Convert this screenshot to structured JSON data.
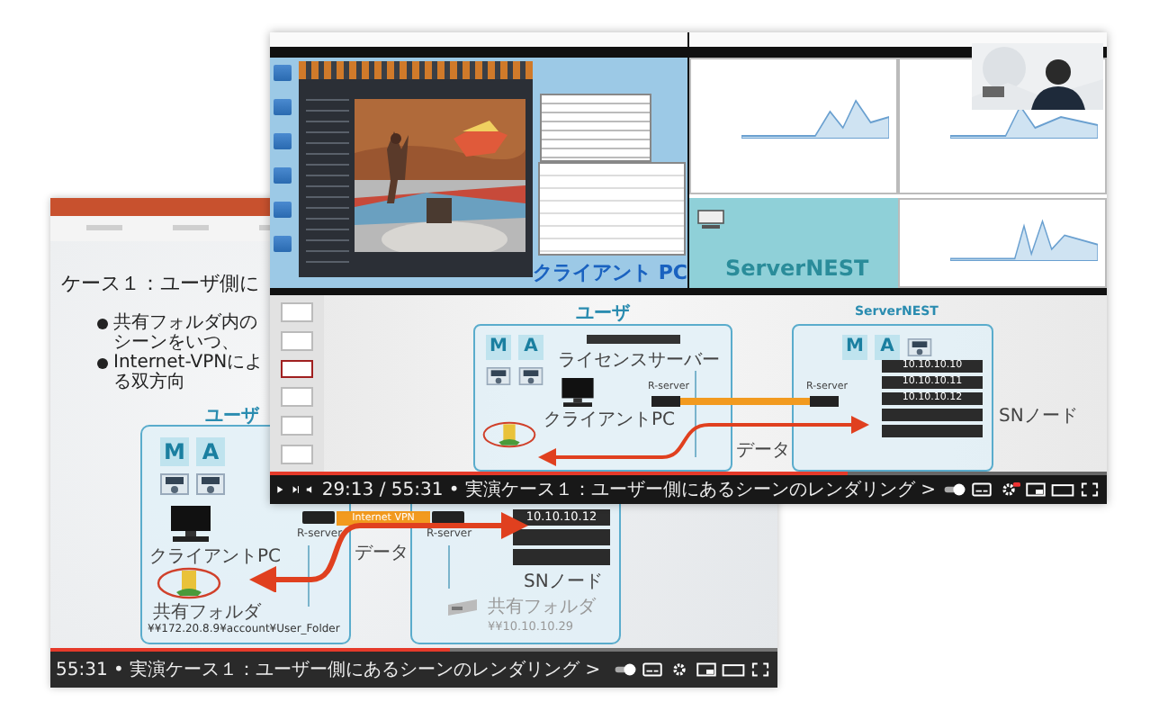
{
  "presentation_window": {
    "slide": {
      "heading": "ケース１：ユーザ側に",
      "bullets": [
        "共有フォルダ内のシーンをいつ、",
        "Internet-VPNによる双方向"
      ],
      "user_group": {
        "label": "ユーザ",
        "apps": [
          "M",
          "A"
        ],
        "client": "クライアントPC",
        "share_name": "共有フォルダ",
        "share_path": "¥¥172.20.8.9¥account¥User_Folder"
      },
      "network": {
        "r_servers": [
          "R-server",
          "R-server"
        ],
        "vpn": "Internet VPN",
        "data": "データ"
      },
      "server_group": {
        "nodes": [
          "10.10.10.12"
        ],
        "node_label": "SNノード",
        "share_name": "共有フォルダ",
        "share_path": "¥¥10.10.10.29"
      }
    },
    "player": {
      "level": 0.55,
      "caption": "55:31 • 実演ケース１：ユーザー側にあるシーンのレンダリング >"
    }
  },
  "demo_window": {
    "remote_desktops": [
      {
        "label": "クライアント PC"
      },
      {
        "label": "ServerNEST"
      }
    ],
    "slide": {
      "thumbnails": [
        {
          "selected": false
        },
        {
          "selected": false
        },
        {
          "selected": true
        },
        {
          "selected": false
        },
        {
          "selected": false
        },
        {
          "selected": false
        }
      ],
      "user_group": {
        "label": "ユーザ",
        "apps": [
          "M",
          "A"
        ],
        "license_server": "ライセンスサーバー",
        "client": "クライアントPC"
      },
      "network": {
        "r_servers": [
          "R-server",
          "R-server"
        ],
        "data": "データ"
      },
      "server_group": {
        "label": "ServerNEST",
        "apps": [
          "M",
          "A"
        ],
        "nodes": [
          "10.10.10.10",
          "10.10.10.11",
          "10.10.10.12"
        ],
        "node_label": "SNノード"
      }
    },
    "player": {
      "level": 0.69,
      "caption": "29:13 / 55:31 • 実演ケース１：ユーザー側にあるシーンのレンダリング >"
    }
  }
}
